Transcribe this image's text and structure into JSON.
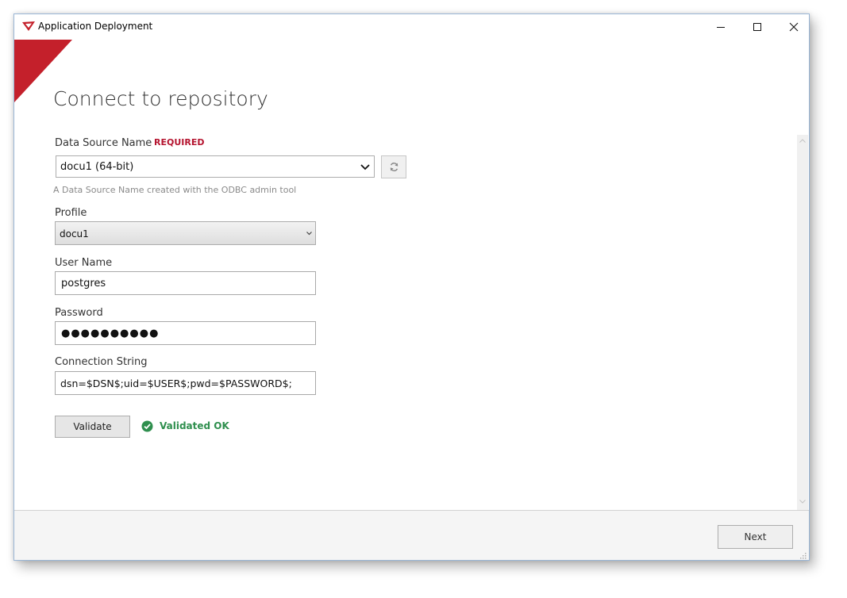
{
  "window": {
    "title": "Application Deployment",
    "accent_color": "#c4202b"
  },
  "page": {
    "title": "Connect to repository"
  },
  "dsn": {
    "label": "Data Source Name",
    "required_badge": "REQUIRED",
    "value": "docu1 (64-bit)",
    "hint": "A Data Source Name created with the ODBC admin tool"
  },
  "profile": {
    "label": "Profile",
    "value": "docu1"
  },
  "user_name": {
    "label": "User Name",
    "value": "postgres"
  },
  "password": {
    "label": "Password",
    "value": "●●●●●●●●●●"
  },
  "connection_string": {
    "label": "Connection String",
    "value": "dsn=$DSN$;uid=$USER$;pwd=$PASSWORD$;"
  },
  "validate": {
    "button_label": "Validate",
    "status": "Validated OK",
    "status_color": "#2f8f4e"
  },
  "footer": {
    "next_label": "Next"
  },
  "icons": {
    "app": "app-logo-icon",
    "refresh": "refresh-icon",
    "validated": "check-circle-icon"
  }
}
